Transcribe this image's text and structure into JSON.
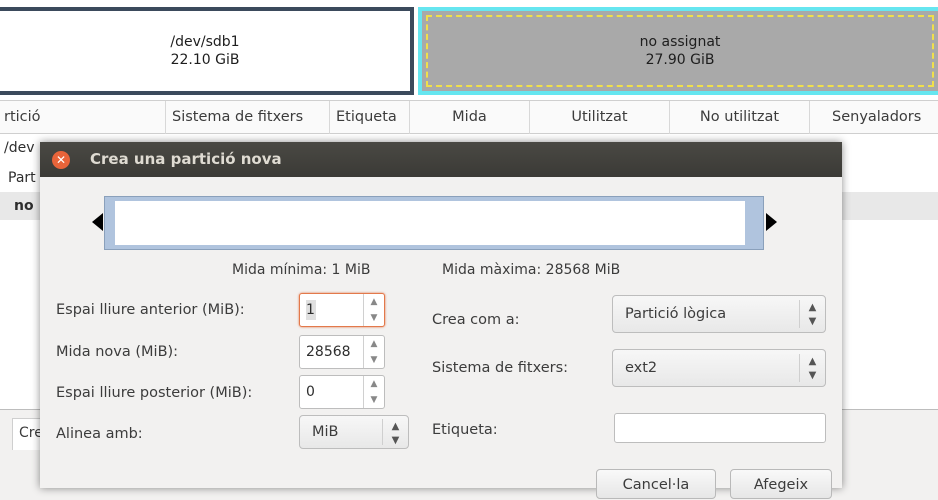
{
  "partition_map": {
    "seg1": {
      "name": "/dev/sdb1",
      "size": "22.10 GiB"
    },
    "seg2": {
      "name": "no assignat",
      "size": "27.90 GiB"
    }
  },
  "table": {
    "columns": [
      "rtició",
      "Sistema de fitxers",
      "Etiqueta",
      "Mida",
      "Utilitzat",
      "No utilitzat",
      "Senyaladors"
    ],
    "rows_partial": [
      "/dev",
      "Part",
      "no"
    ]
  },
  "bottom_tab": "Cre",
  "dialog": {
    "title": "Crea una partició nova",
    "min_size": "Mida mínima: 1 MiB",
    "max_size": "Mida màxima: 28568 MiB",
    "free_before_label": "Espai lliure anterior (MiB):",
    "free_before_value": "1",
    "new_size_label": "Mida nova (MiB):",
    "new_size_value": "28568",
    "free_after_label": "Espai lliure posterior (MiB):",
    "free_after_value": "0",
    "align_label": "Alinea amb:",
    "align_value": "MiB",
    "create_as_label": "Crea com a:",
    "create_as_value": "Partició lògica",
    "fs_label": "Sistema de fitxers:",
    "fs_value": "ext2",
    "label_label": "Etiqueta:",
    "label_value": "",
    "cancel": "Cancel·la",
    "add": "Afegeix"
  },
  "colors": {
    "titlebar": "#3b3a36",
    "close_button": "#e8643a",
    "focus_border": "#e3794b",
    "unallocated_border": "#66e6f0",
    "resizer": "#b0c4de"
  }
}
